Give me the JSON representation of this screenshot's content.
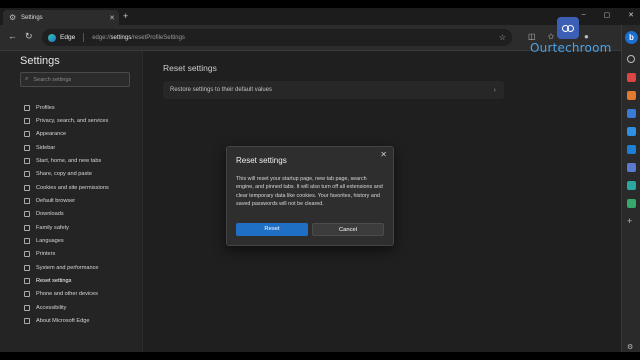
{
  "browser": {
    "tab_title": "Settings",
    "tab_close": "✕",
    "new_tab": "+",
    "site_name": "Edge",
    "url_prefix": "edge://",
    "url_bold": "settings",
    "url_rest": "/resetProfileSettings"
  },
  "watermark": {
    "text": "Ourtechroom"
  },
  "settings": {
    "heading": "Settings",
    "search_placeholder": "Search settings",
    "nav_items": [
      {
        "label": "Profiles",
        "icon": "profile-icon"
      },
      {
        "label": "Privacy, search, and services",
        "icon": "lock-icon"
      },
      {
        "label": "Appearance",
        "icon": "appearance-icon"
      },
      {
        "label": "Sidebar",
        "icon": "sidebar-icon"
      },
      {
        "label": "Start, home, and new tabs",
        "icon": "home-icon"
      },
      {
        "label": "Share, copy and paste",
        "icon": "share-icon"
      },
      {
        "label": "Cookies and site permissions",
        "icon": "cookie-icon"
      },
      {
        "label": "Default browser",
        "icon": "browser-icon"
      },
      {
        "label": "Downloads",
        "icon": "download-icon"
      },
      {
        "label": "Family safety",
        "icon": "family-icon"
      },
      {
        "label": "Languages",
        "icon": "language-icon"
      },
      {
        "label": "Printers",
        "icon": "printer-icon"
      },
      {
        "label": "System and performance",
        "icon": "system-icon"
      },
      {
        "label": "Reset settings",
        "icon": "reset-icon",
        "active": true
      },
      {
        "label": "Phone and other devices",
        "icon": "phone-icon"
      },
      {
        "label": "Accessibility",
        "icon": "accessibility-icon"
      },
      {
        "label": "About Microsoft Edge",
        "icon": "edge-icon"
      }
    ]
  },
  "main": {
    "title": "Reset settings",
    "restore_row": "Restore settings to their default values"
  },
  "dialog": {
    "title": "Reset settings",
    "body": "This will reset your startup page, new tab page, search engine, and pinned tabs. It will also turn off all extensions and clear temporary data like cookies. Your favorites, history and saved passwords will not be cleared.",
    "primary_button": "Reset",
    "secondary_button": "Cancel",
    "close": "✕"
  },
  "colors": {
    "accent": "#1f6fc5",
    "background": "#242424"
  }
}
